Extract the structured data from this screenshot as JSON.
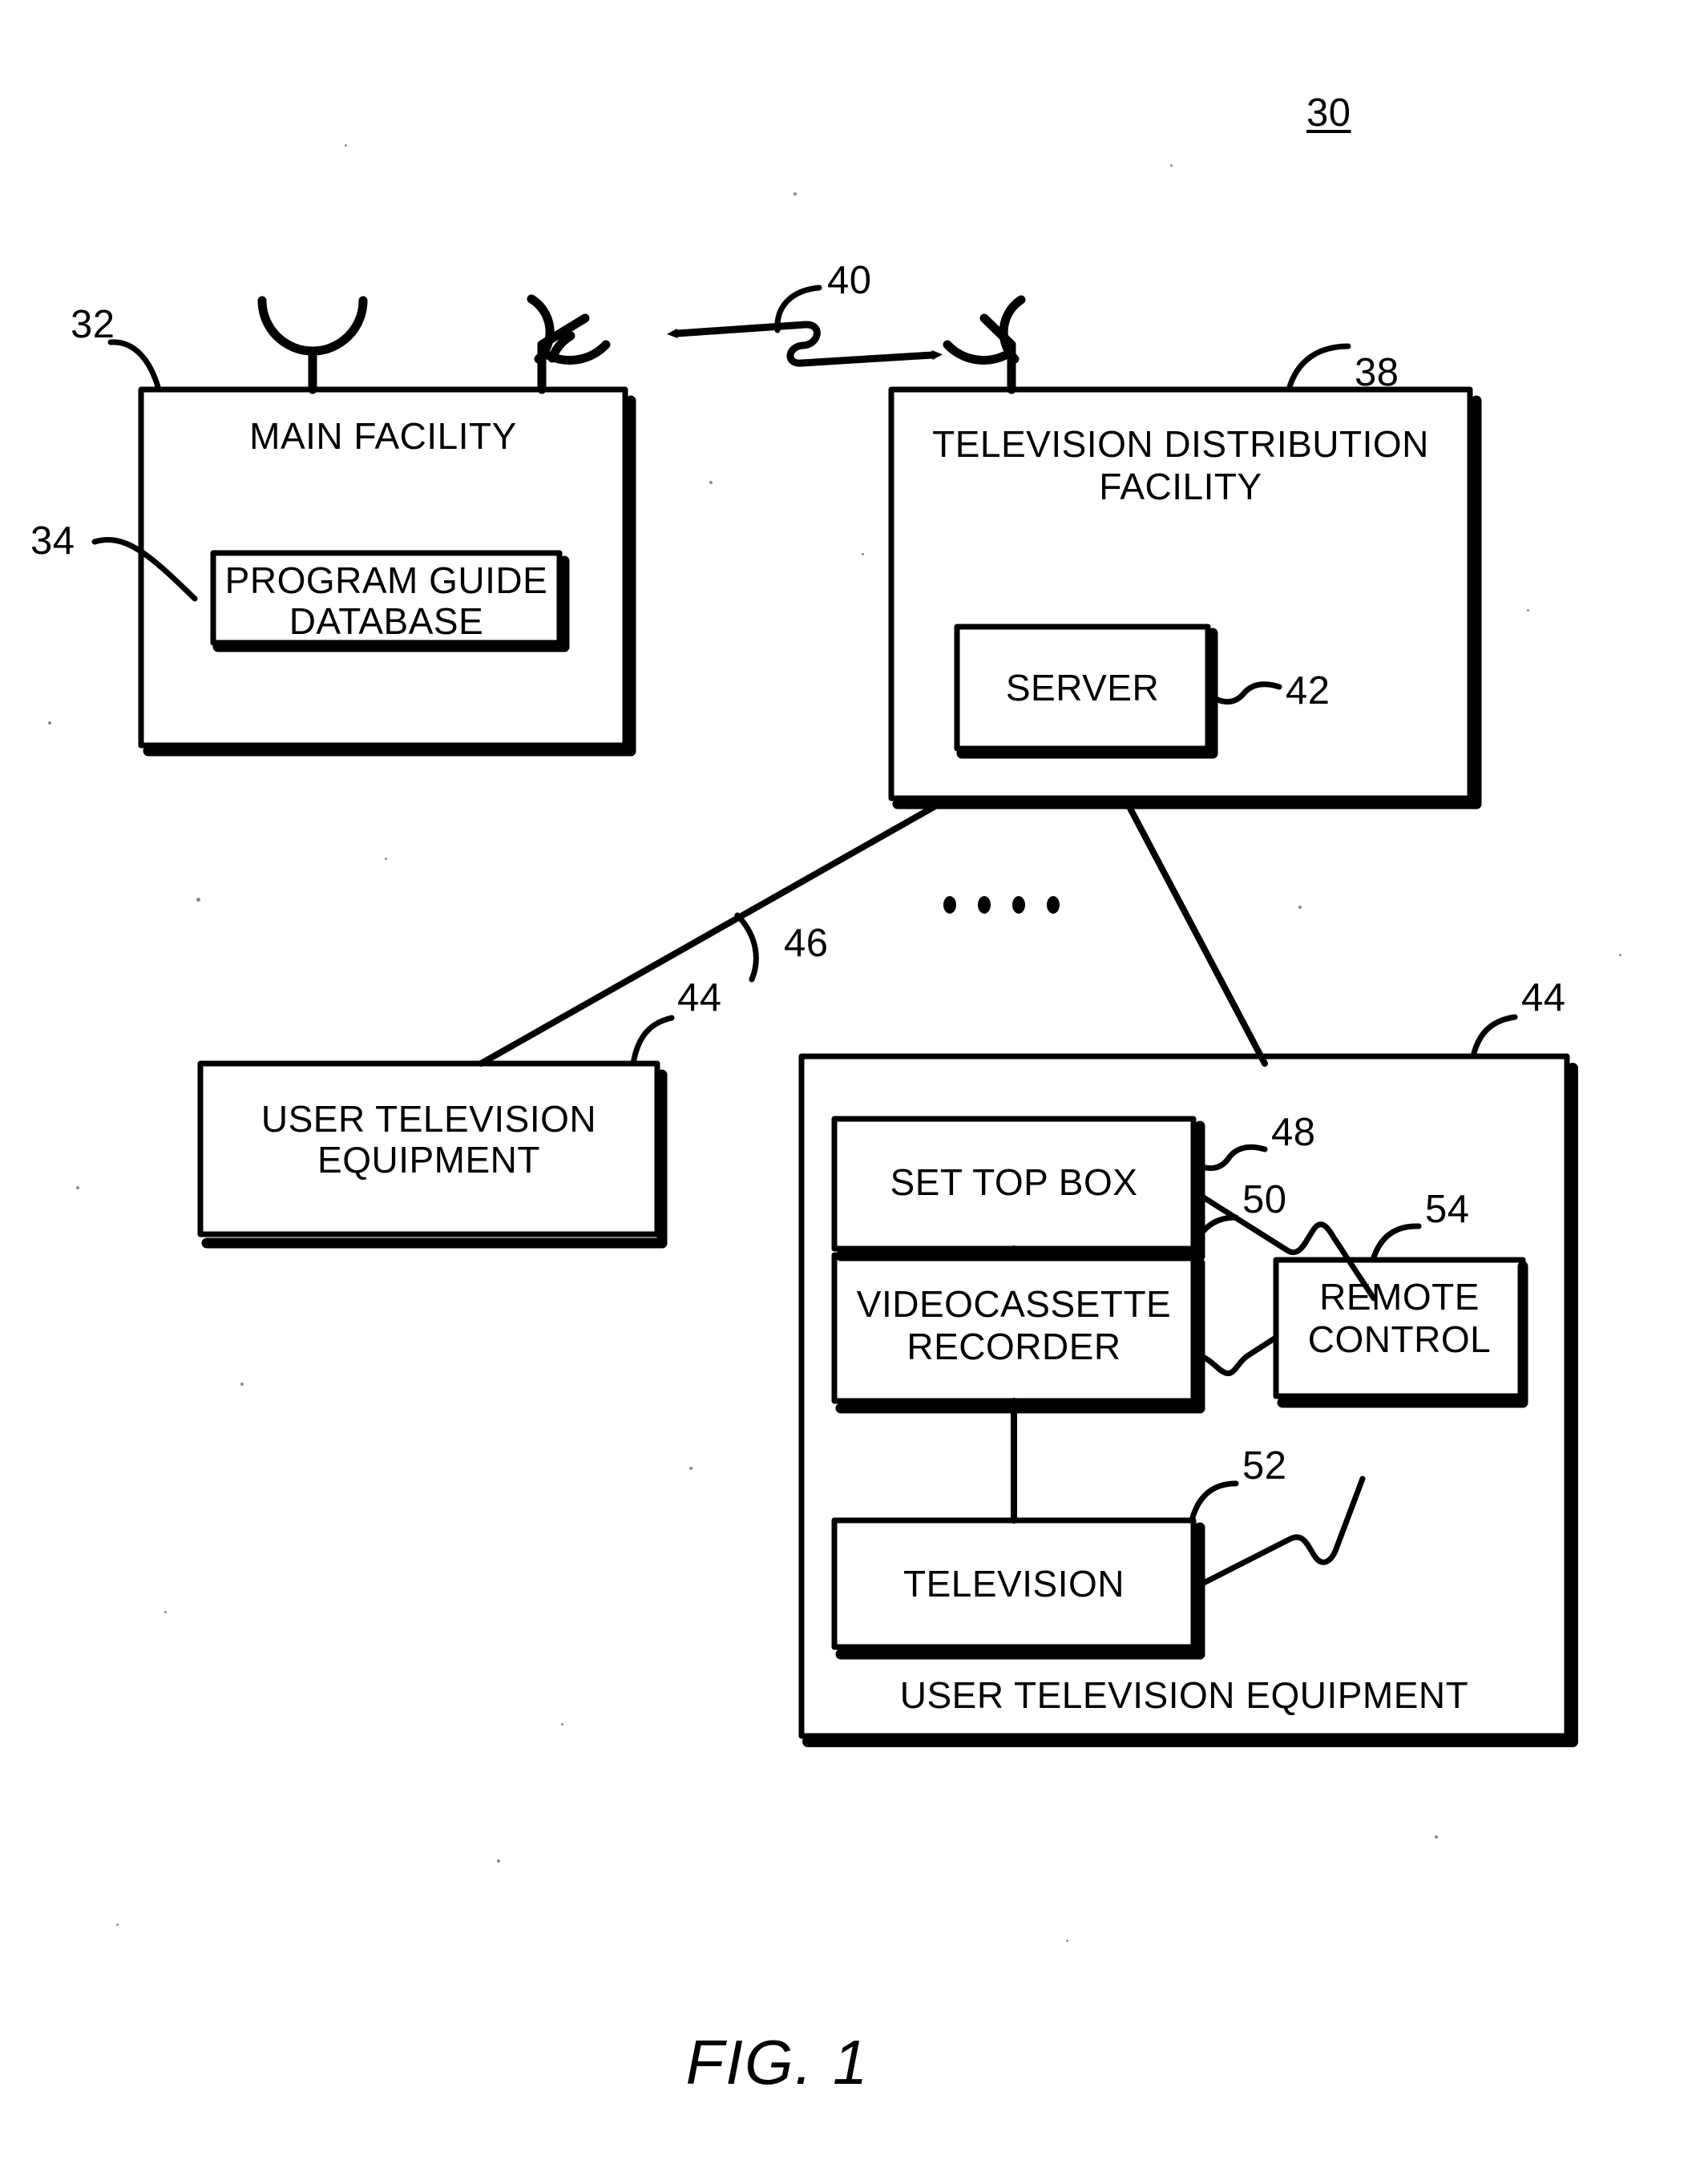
{
  "figure": {
    "caption": "FIG. 1",
    "system_ref": "30",
    "type": "patent-block-diagram"
  },
  "nodes": {
    "main_facility": {
      "label": "MAIN FACILITY",
      "ref": "32"
    },
    "program_guide_database": {
      "label_line1": "PROGRAM GUIDE",
      "label_line2": "DATABASE",
      "ref": "34"
    },
    "television_distribution_facility": {
      "label_line1": "TELEVISION DISTRIBUTION",
      "label_line2": "FACILITY",
      "ref": "38"
    },
    "server": {
      "label": "SERVER",
      "ref": "42"
    },
    "user_television_equipment_left": {
      "label_line1": "USER TELEVISION",
      "label_line2": "EQUIPMENT",
      "ref": "44"
    },
    "user_television_equipment_right": {
      "label": "USER TELEVISION EQUIPMENT",
      "ref": "44"
    },
    "set_top_box": {
      "label": "SET TOP BOX",
      "ref": "48"
    },
    "videocassette_recorder": {
      "label_line1": "VIDEOCASSETTE",
      "label_line2": "RECORDER",
      "ref": "50"
    },
    "television": {
      "label": "TELEVISION",
      "ref": "52"
    },
    "remote_control": {
      "label_line1": "REMOTE",
      "label_line2": "CONTROL",
      "ref": "54"
    }
  },
  "links": {
    "wireless_link": {
      "ref": "40",
      "style": "double-headed-arrow-with-squiggle"
    },
    "distribution_path": {
      "ref": "46",
      "style": "straight-line"
    },
    "continuation_dots": "• • • •"
  },
  "colors": {
    "ink": "#000000",
    "paper": "#ffffff"
  }
}
